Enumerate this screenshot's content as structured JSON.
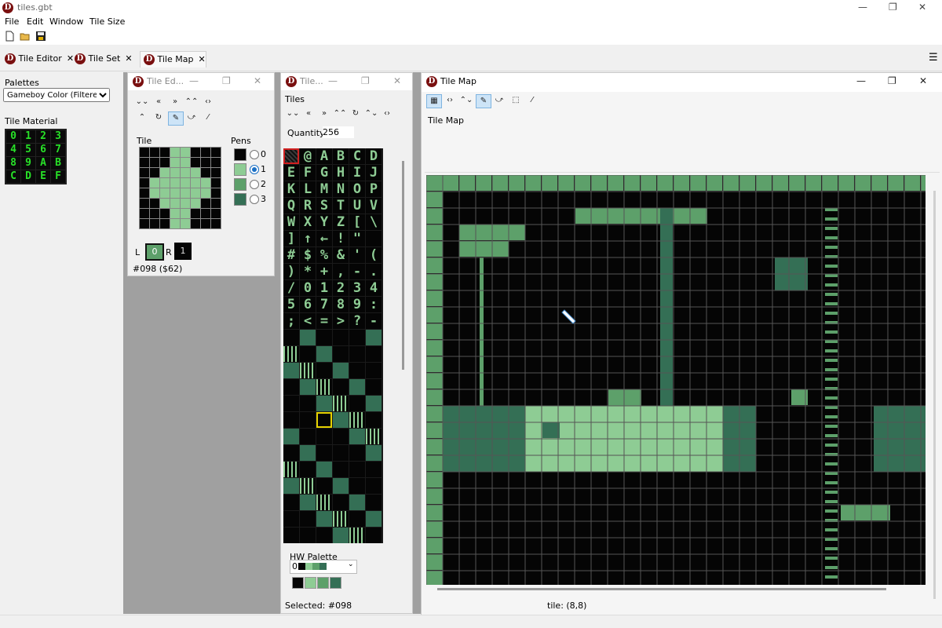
{
  "app": {
    "title": "tiles.gbt",
    "icon_letter": "D",
    "menu": [
      "File",
      "Edit",
      "Window",
      "Tile Size"
    ],
    "toolbar_icons": [
      "new-file-icon",
      "open-folder-icon",
      "save-icon"
    ],
    "tabs": [
      {
        "label": "Tile Editor",
        "active": false
      },
      {
        "label": "Tile Set",
        "active": false
      },
      {
        "label": "Tile Map",
        "active": true
      }
    ],
    "window_controls": {
      "minimize": "—",
      "maximize": "❐",
      "close": "✕"
    },
    "hamburger": "☰"
  },
  "left_panel": {
    "palettes_label": "Palettes",
    "palette_selected": "Gameboy Color (Filtered)",
    "tile_material_label": "Tile Material",
    "material": [
      "0",
      "1",
      "2",
      "3",
      "4",
      "5",
      "6",
      "7",
      "8",
      "9",
      "A",
      "B",
      "C",
      "D",
      "E",
      "F"
    ]
  },
  "tile_editor_win": {
    "title": "Tile Ed...",
    "tools_row1": [
      "⌄⌄",
      "«",
      "»",
      "⌃⌃",
      "‹›"
    ],
    "tools_row2": [
      "⌃",
      "↻",
      "✎",
      "⤻",
      "⁄"
    ],
    "tile_label": "Tile",
    "pens_label": "Pens",
    "pens": [
      {
        "value": "0",
        "color": "#050505"
      },
      {
        "value": "1",
        "color": "#8ecc94"
      },
      {
        "value": "2",
        "color": "#5da06a"
      },
      {
        "value": "3",
        "color": "#346f55"
      }
    ],
    "pen_selected": 1,
    "pixels": [
      [
        0,
        0,
        0,
        1,
        1,
        0,
        0,
        0
      ],
      [
        0,
        0,
        0,
        1,
        1,
        0,
        0,
        0
      ],
      [
        0,
        0,
        1,
        1,
        1,
        1,
        0,
        0
      ],
      [
        0,
        1,
        1,
        1,
        1,
        1,
        1,
        0
      ],
      [
        0,
        1,
        1,
        1,
        1,
        1,
        1,
        0
      ],
      [
        0,
        0,
        1,
        1,
        1,
        1,
        0,
        0
      ],
      [
        0,
        0,
        0,
        1,
        1,
        0,
        0,
        0
      ],
      [
        0,
        0,
        0,
        1,
        1,
        0,
        0,
        0
      ]
    ],
    "l_label": "L",
    "l_value": "0",
    "r_label": "R",
    "r_value": "1",
    "status": "#098 ($62)"
  },
  "tileset_win": {
    "title": "Tile...",
    "tiles_label": "Tiles",
    "tools": [
      "⌄⌄",
      "«",
      "»",
      "⌃⌃",
      "↻",
      "⌃⌄",
      "‹›"
    ],
    "quantity_label": "Quantity",
    "quantity_value": "256",
    "glyphs": [
      "",
      "@",
      "A",
      "B",
      "C",
      "D",
      "E",
      "F",
      "G",
      "H",
      "I",
      "J",
      "K",
      "L",
      "M",
      "N",
      "O",
      "P",
      "Q",
      "R",
      "S",
      "T",
      "U",
      "V",
      "W",
      "X",
      "Y",
      "Z",
      "[",
      "\\",
      "]",
      "↑",
      "←",
      "!",
      "\"",
      "",
      "#",
      "$",
      "%",
      "&",
      "'",
      "(",
      ")",
      "*",
      "+",
      ",",
      "-",
      ".",
      "/",
      "0",
      "1",
      "2",
      "3",
      "4",
      "5",
      "6",
      "7",
      "8",
      "9",
      ":",
      ";",
      "<",
      "=",
      ">",
      "?",
      "-"
    ],
    "hw_palette_label": "HW Palette",
    "hw_palette_value": "0",
    "hw_colors": [
      "#050505",
      "#8ecc94",
      "#5da06a",
      "#346f55"
    ],
    "status": "Selected: #098"
  },
  "tilemap_win": {
    "title": "Tile Map",
    "section_label": "Tile Map",
    "tools": [
      "grid-icon",
      "flip-h-icon",
      "flip-v-icon",
      "pencil-icon",
      "fill-icon",
      "select-icon",
      "eyedropper-icon"
    ],
    "status": "tile: (8,8)"
  },
  "colors": {
    "gb_dark": "#050505",
    "gb_light": "#8ecc94",
    "gb_mid": "#5da06a",
    "gb_darkgreen": "#346f55",
    "accent": "#1a6fc4",
    "app_icon": "#7a1010"
  }
}
